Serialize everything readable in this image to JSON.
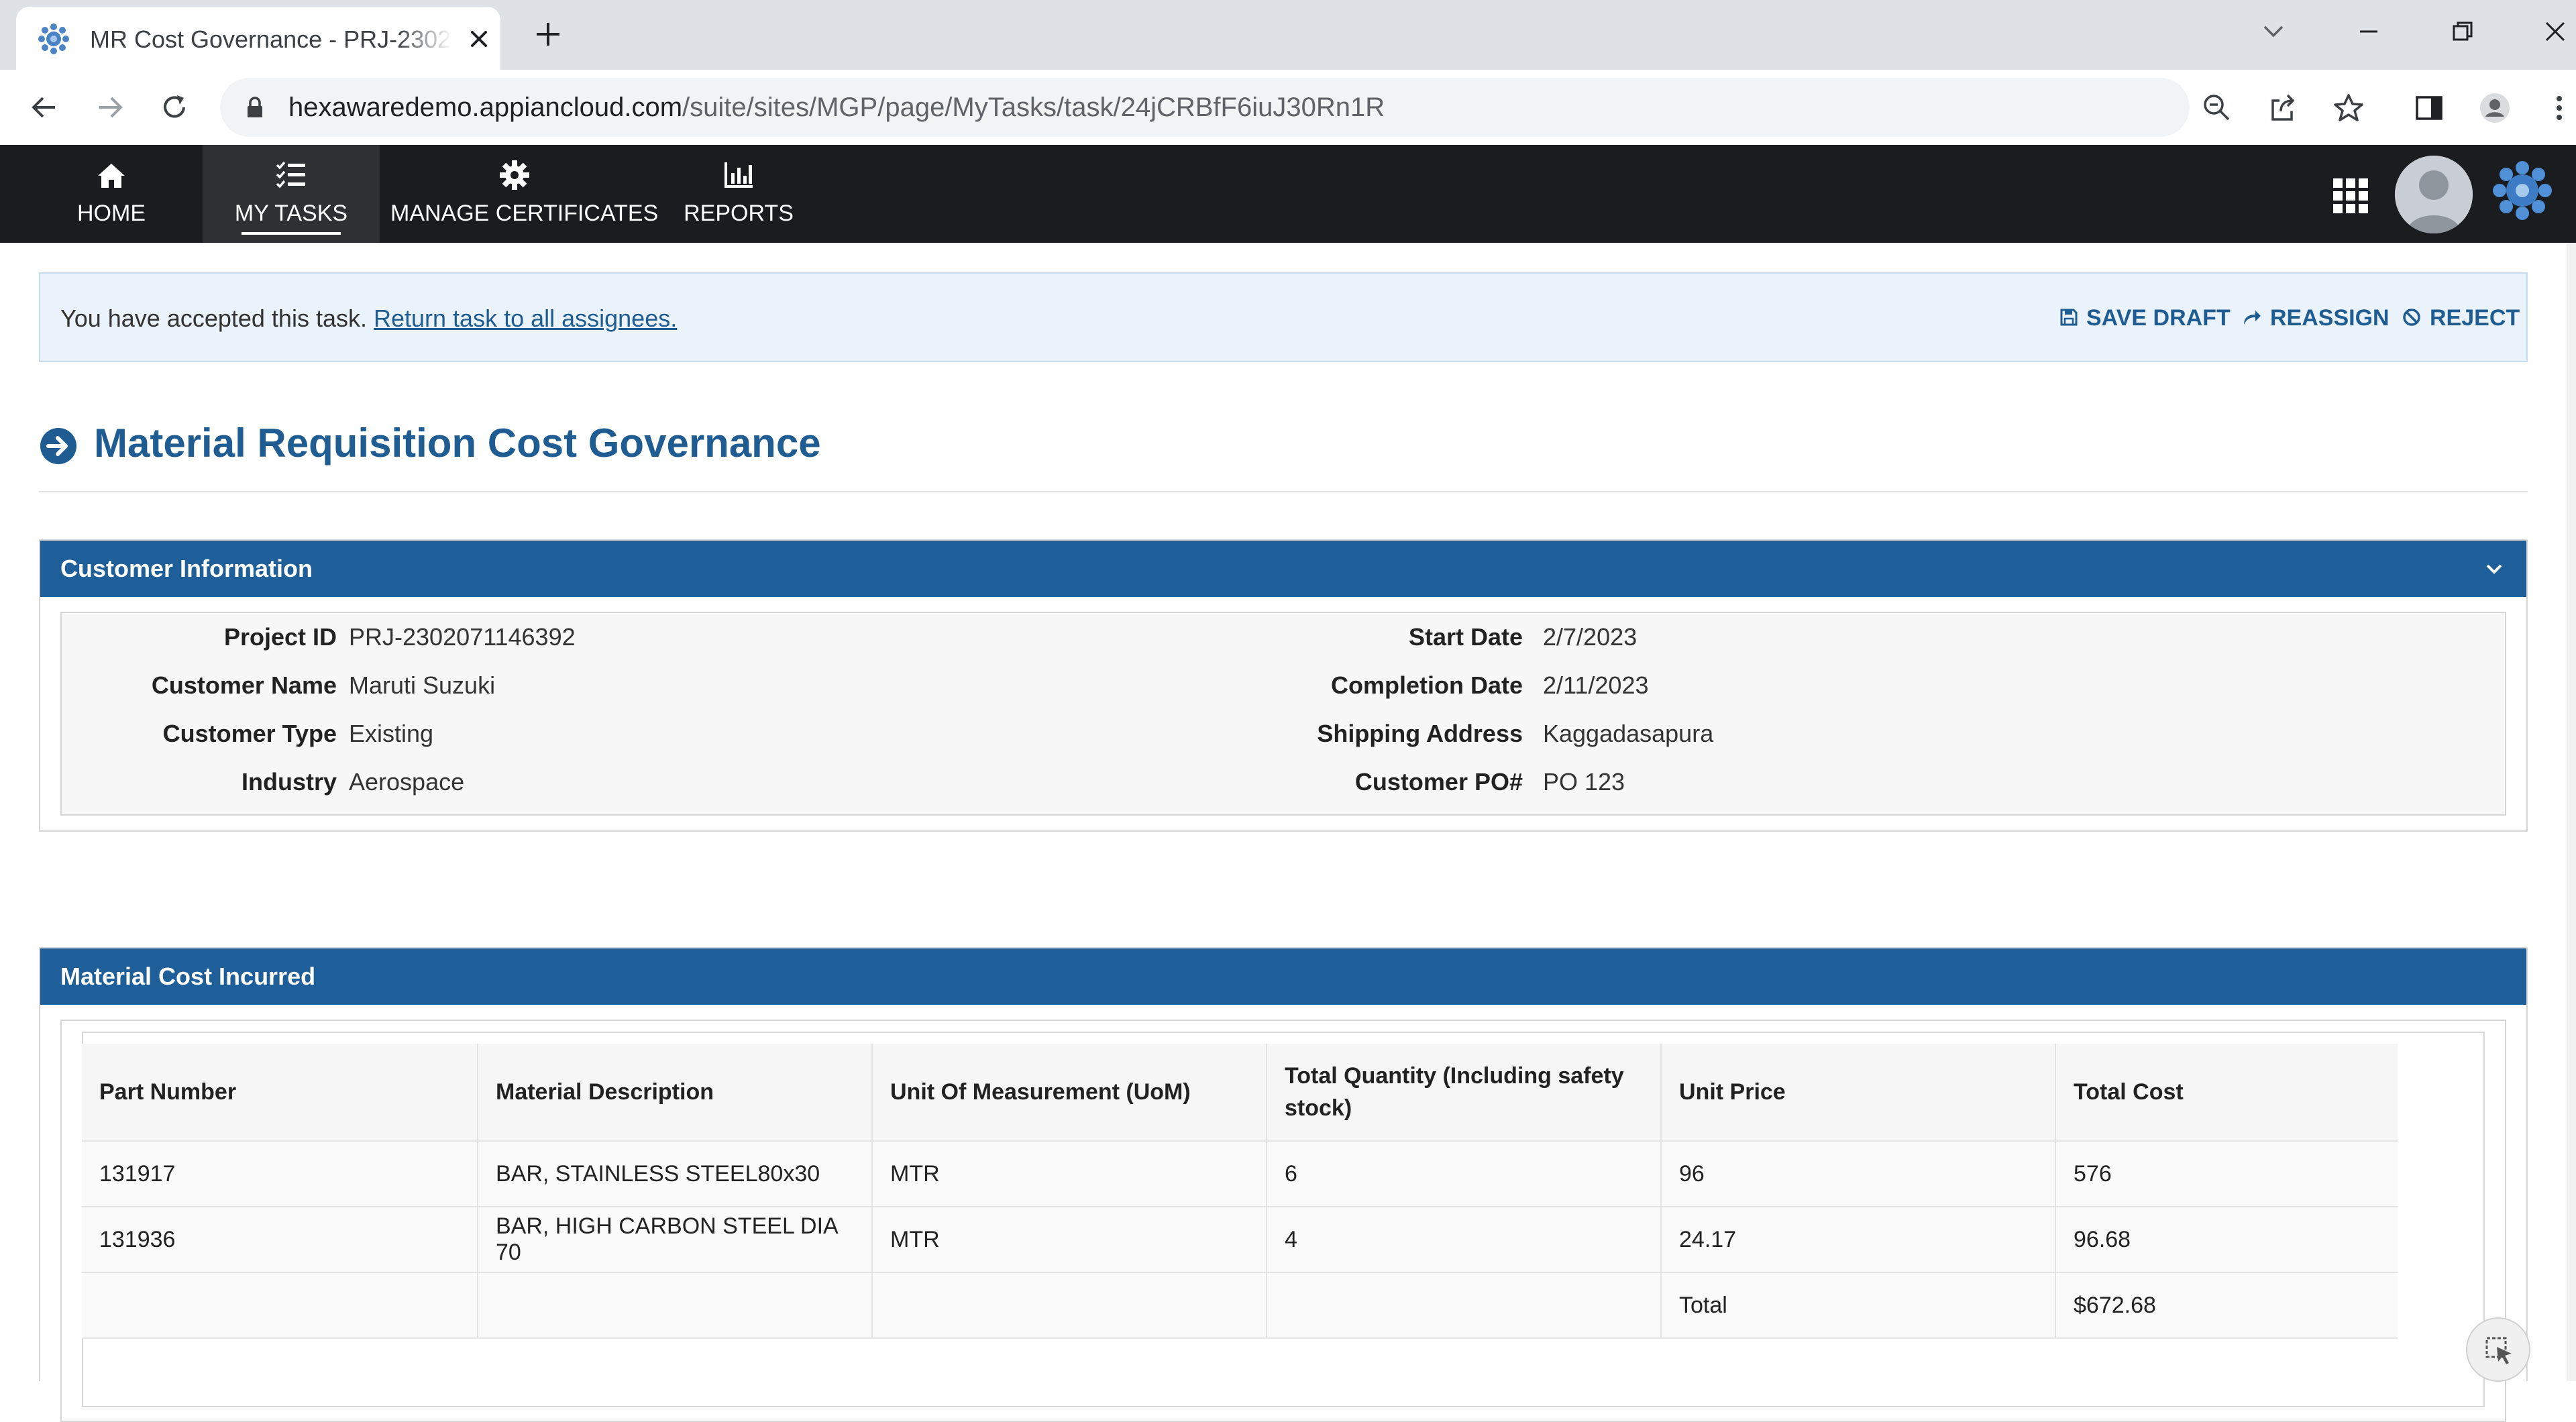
{
  "browser": {
    "tab_title": "MR Cost Governance - PRJ-2302071146392",
    "url_host": "hexawaredemo.appiancloud.com",
    "url_path": "/suite/sites/MGP/page/MyTasks/task/24jCRBfF6iuJ30Rn1R"
  },
  "appnav": {
    "items": [
      {
        "label": "HOME",
        "icon": "home-icon"
      },
      {
        "label": "MY TASKS",
        "icon": "tasks-icon",
        "active": true
      },
      {
        "label": "MANAGE CERTIFICATES",
        "icon": "gear-icon"
      },
      {
        "label": "REPORTS",
        "icon": "bar-chart-icon"
      }
    ]
  },
  "notice": {
    "text": "You have accepted this task.",
    "link": "Return task to all assignees.",
    "actions": {
      "save_draft": "SAVE DRAFT",
      "reassign": "REASSIGN",
      "reject": "REJECT"
    }
  },
  "page": {
    "title": "Material Requisition Cost Governance"
  },
  "customer_info": {
    "header": "Customer Information",
    "left": [
      {
        "label": "Project ID",
        "value": "PRJ-2302071146392"
      },
      {
        "label": "Customer Name",
        "value": "Maruti Suzuki"
      },
      {
        "label": "Customer Type",
        "value": "Existing"
      },
      {
        "label": "Industry",
        "value": "Aerospace"
      }
    ],
    "right": [
      {
        "label": "Start Date",
        "value": "2/7/2023"
      },
      {
        "label": "Completion Date",
        "value": "2/11/2023"
      },
      {
        "label": "Shipping Address",
        "value": "Kaggadasapura"
      },
      {
        "label": "Customer PO#",
        "value": "PO 123"
      }
    ]
  },
  "material_cost": {
    "header": "Material Cost Incurred",
    "columns": [
      "Part Number",
      "Material Description",
      "Unit Of Measurement (UoM)",
      "Total Quantity (Including safety stock)",
      "Unit Price",
      "Total Cost"
    ],
    "rows": [
      [
        "131917",
        "BAR, STAINLESS STEEL80x30",
        "MTR",
        "6",
        "96",
        "576"
      ],
      [
        "131936",
        "BAR, HIGH CARBON STEEL DIA 70",
        "MTR",
        "4",
        "24.17",
        "96.68"
      ]
    ],
    "total_label": "Total",
    "total_value": "$672.68"
  },
  "colors": {
    "brand_blue": "#1f5f99",
    "link_blue": "#1e5c92",
    "nav_bg": "#1b1c1f",
    "notice_bg": "#eaf3fb"
  }
}
